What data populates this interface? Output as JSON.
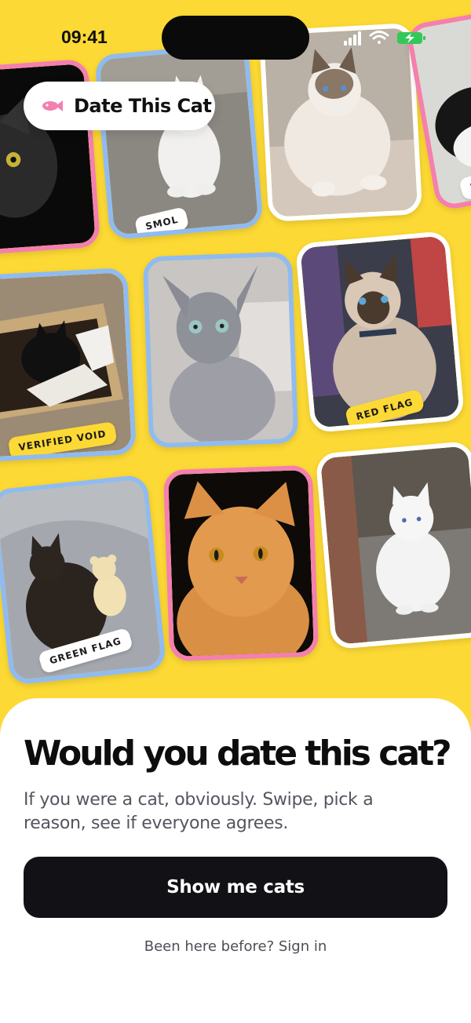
{
  "status_bar": {
    "time": "09:41",
    "icons": [
      "signal-icon",
      "wifi-icon",
      "battery-charging-icon"
    ],
    "battery_color": "#34c759"
  },
  "app": {
    "name": "Date This Cat",
    "logo_icon": "fish-icon",
    "logo_color": "#f47fb0"
  },
  "collage": {
    "background": "#fcd934",
    "cards": [
      {
        "id": "black-cat",
        "border": "pink",
        "subject": "black cat"
      },
      {
        "id": "white-kitten",
        "border": "blue",
        "subject": "white kitten",
        "tag": "SMOL",
        "tag_style": "white"
      },
      {
        "id": "ragdoll",
        "border": "white",
        "subject": "ragdoll cat on chair"
      },
      {
        "id": "edge-card",
        "border": "pink",
        "subject": "black and white cat",
        "tag": "DIV",
        "tag_style": "white"
      },
      {
        "id": "box-cat",
        "border": "blue",
        "subject": "black cat in box",
        "tag": "VERIFIED VOID",
        "tag_style": "yellow"
      },
      {
        "id": "sphynx",
        "border": "blue",
        "subject": "sphynx cat"
      },
      {
        "id": "siamese",
        "border": "white",
        "subject": "siamese cat",
        "tag": "RED FLAG",
        "tag_style": "yellow"
      },
      {
        "id": "teddy-cat",
        "border": "blue",
        "subject": "black cat with teddy bear",
        "tag": "GREEN FLAG",
        "tag_style": "white"
      },
      {
        "id": "orange-cat",
        "border": "pink",
        "subject": "orange tabby cat"
      },
      {
        "id": "white-cat",
        "border": "white",
        "subject": "white cat"
      }
    ]
  },
  "sheet": {
    "headline": "Would you date this cat?",
    "subtitle": "If you were a cat, obviously. Swipe, pick a reason, see if everyone agrees.",
    "cta_label": "Show me cats",
    "signin_label": "Been here before? Sign in"
  },
  "colors": {
    "accent_yellow": "#fcd934",
    "border_pink": "#f47fb0",
    "border_blue": "#8fbbf2",
    "cta_background": "#111116"
  }
}
